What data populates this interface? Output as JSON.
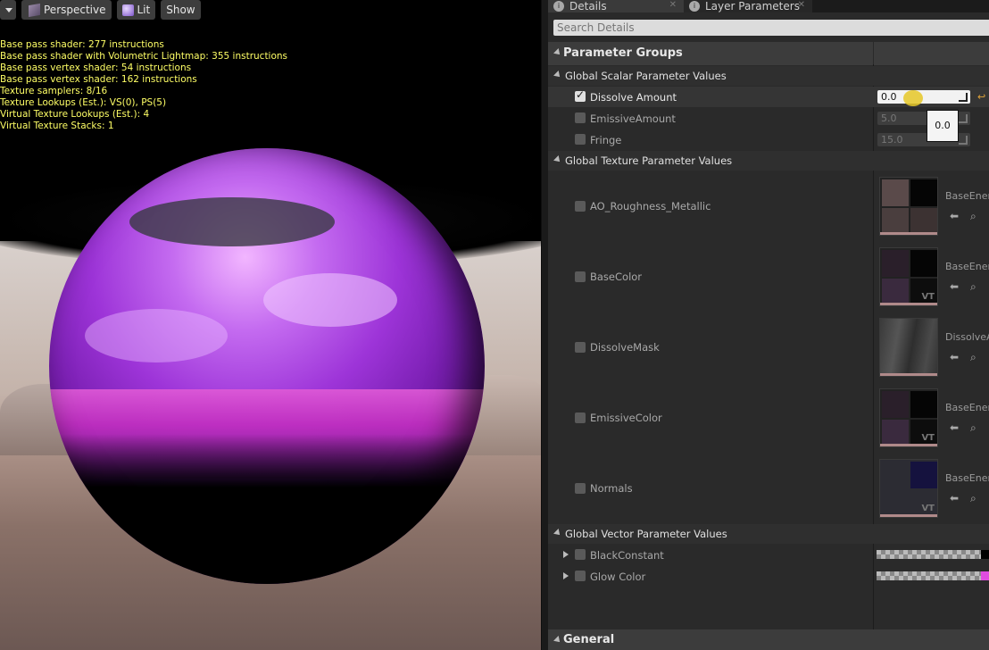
{
  "viewport": {
    "toolbar": {
      "perspective_label": "Perspective",
      "lit_label": "Lit",
      "show_label": "Show"
    },
    "stats": [
      "Base pass shader: 277 instructions",
      "Base pass shader with Volumetric Lightmap: 355 instructions",
      "Base pass vertex shader: 54 instructions",
      "Base pass vertex shader: 162 instructions",
      "Texture samplers: 8/16",
      "Texture Lookups (Est.): VS(0), PS(5)",
      "Virtual Texture Lookups (Est.): 4",
      "Virtual Texture Stacks: 1"
    ]
  },
  "tabs": {
    "details": "Details",
    "layer_parameters": "Layer Parameters"
  },
  "search": {
    "placeholder": "Search Details"
  },
  "parameter_groups": {
    "title": "Parameter Groups",
    "scalar": {
      "title": "Global Scalar Parameter Values",
      "items": [
        {
          "name": "Dissolve Amount",
          "value": "0.0",
          "checked": true
        },
        {
          "name": "EmissiveAmount",
          "value": "5.0",
          "checked": false
        },
        {
          "name": "Fringe",
          "value": "15.0",
          "checked": false
        }
      ],
      "tooltip": "0.0"
    },
    "texture": {
      "title": "Global Texture Parameter Values",
      "items": [
        {
          "name": "AO_Roughness_Metallic",
          "asset": "BaseEnen"
        },
        {
          "name": "BaseColor",
          "asset": "BaseEnen"
        },
        {
          "name": "DissolveMask",
          "asset": "DissolveA"
        },
        {
          "name": "EmissiveColor",
          "asset": "BaseEnen"
        },
        {
          "name": "Normals",
          "asset": "BaseEnen"
        }
      ],
      "vt_label": "VT"
    },
    "vector": {
      "title": "Global Vector Parameter Values",
      "items": [
        {
          "name": "BlackConstant",
          "color": "#000000"
        },
        {
          "name": "Glow Color",
          "color": "#e04de0"
        }
      ]
    }
  },
  "general": {
    "title": "General"
  }
}
